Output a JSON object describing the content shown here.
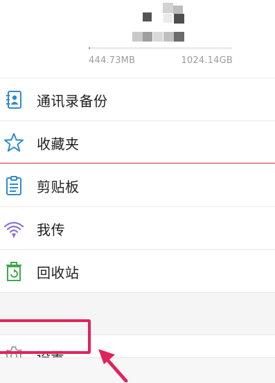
{
  "header": {
    "storage_used": "444.73MB",
    "storage_total": "1024.14GB",
    "storage_used_fraction": 0.0004
  },
  "menu": {
    "items": [
      {
        "label": "通讯录备份",
        "icon": "contacts-backup-icon"
      },
      {
        "label": "收藏夹",
        "icon": "star-icon"
      },
      {
        "label": "剪贴板",
        "icon": "clipboard-icon"
      },
      {
        "label": "我传",
        "icon": "wireless-transfer-icon"
      },
      {
        "label": "回收站",
        "icon": "recycle-bin-icon"
      }
    ],
    "settings": {
      "label": "设置",
      "icon": "gear-icon"
    }
  },
  "colors": {
    "highlight": "#e0235b",
    "accent_blue": "#2f8bc9",
    "accent_purple": "#8a73c9",
    "accent_green": "#3ea84a",
    "divider_red": "#d7413f"
  }
}
